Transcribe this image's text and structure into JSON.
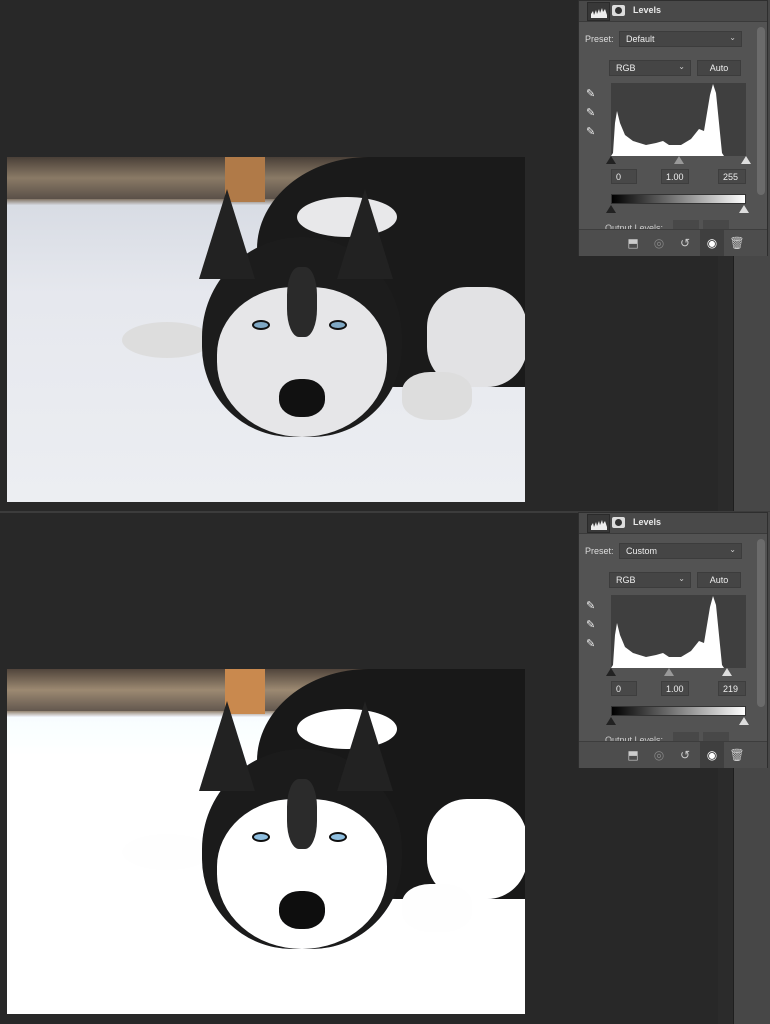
{
  "panels": [
    {
      "title": "Levels",
      "preset_label": "Preset:",
      "preset_value": "Default",
      "channel": "RGB",
      "auto_label": "Auto",
      "input_black": "0",
      "input_gamma": "1.00",
      "input_white": "255",
      "input_white_level": 255,
      "output_label": "Output Levels:"
    },
    {
      "title": "Levels",
      "preset_label": "Preset:",
      "preset_value": "Custom",
      "channel": "RGB",
      "auto_label": "Auto",
      "input_black": "0",
      "input_gamma": "1.00",
      "input_white": "219",
      "input_white_level": 219,
      "output_label": "Output Levels:"
    }
  ],
  "icons": {
    "adjustment": "levels-histogram-icon",
    "mask": "mask-icon",
    "eyedroppers": [
      "black-point-eyedropper-icon",
      "gray-point-eyedropper-icon",
      "white-point-eyedropper-icon"
    ],
    "footer": [
      "clip-to-layer-icon",
      "view-previous-state-icon",
      "reset-icon",
      "visibility-eye-icon",
      "trash-icon"
    ]
  },
  "colors": {
    "background": "#282828",
    "panel": "#535353",
    "histogram": "#ffffff"
  }
}
